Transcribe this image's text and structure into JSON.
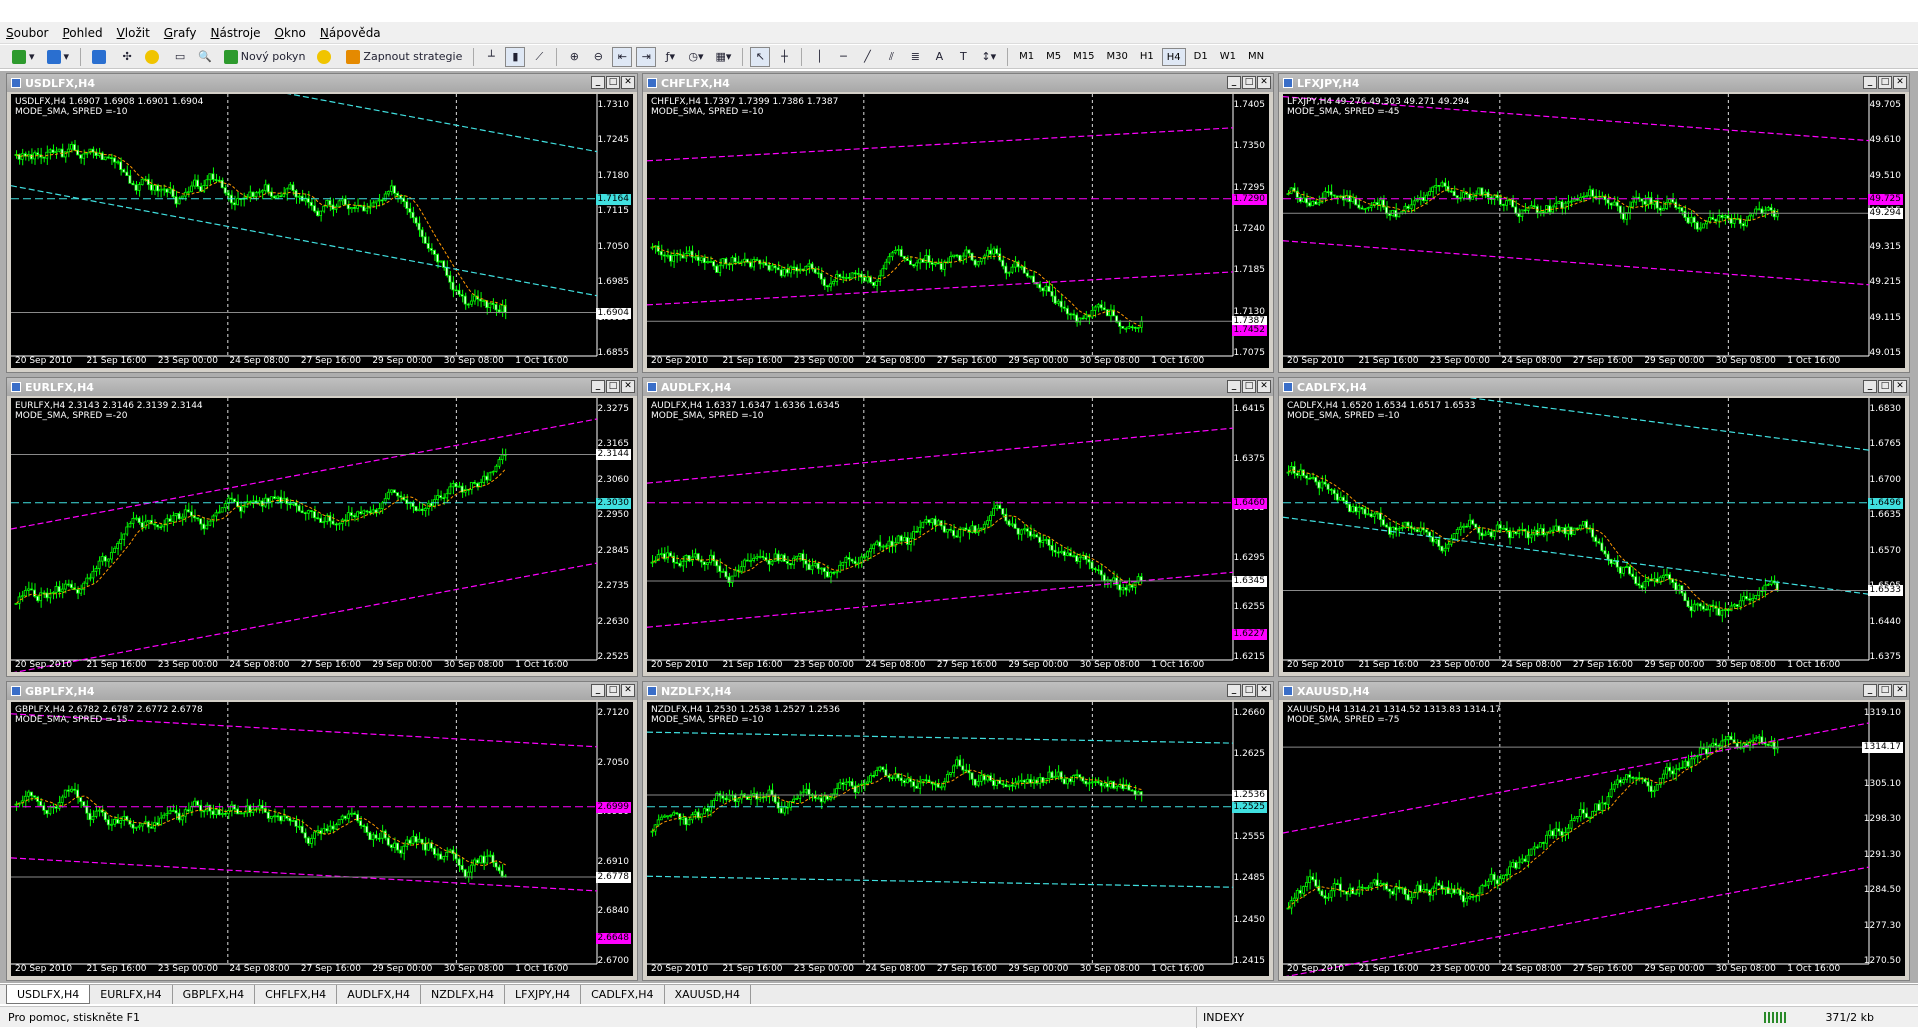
{
  "menu": [
    "Soubor",
    "Pohled",
    "Vložit",
    "Grafy",
    "Nástroje",
    "Okno",
    "Nápověda"
  ],
  "toolbar": {
    "new_order": "Nový pokyn",
    "strategies": "Zapnout strategie",
    "timeframes": [
      "M1",
      "M5",
      "M15",
      "M30",
      "H1",
      "H4",
      "D1",
      "W1",
      "MN"
    ],
    "active_timeframe": "H4"
  },
  "x_axis_labels": [
    "20 Sep 2010",
    "21 Sep 16:00",
    "23 Sep 00:00",
    "24 Sep 08:00",
    "27 Sep 16:00",
    "29 Sep 00:00",
    "30 Sep 08:00",
    "1 Oct 16:00"
  ],
  "colors": {
    "candle": "#00ff00",
    "grid": "#aaaaaa",
    "ma": "#ff9900",
    "cyan": "#40e0e0",
    "magenta": "#ff00ff",
    "red": "#ff3030",
    "orange": "#ff8c1a"
  },
  "charts": [
    {
      "title": "USDLFX,H4",
      "info1": "USDLFX,H4  1.6907 1.6908 1.6901 1.6904",
      "info2": "MODE_SMA, SPRED =-10",
      "yticks": [
        "1.7310",
        "1.7245",
        "1.7180",
        "1.7115",
        "1.7050",
        "1.6985",
        "1.6920",
        "1.6855"
      ],
      "price": "1.6904",
      "tag": "1.7164",
      "tag_color": "cyan",
      "trend": -1,
      "seed": 3
    },
    {
      "title": "CHFLFX,H4",
      "info1": "CHFLFX,H4  1.7397 1.7399 1.7386 1.7387",
      "info2": "MODE_SMA, SPRED =-10",
      "yticks": [
        "1.7405",
        "1.7350",
        "1.7295",
        "1.7240",
        "1.7185",
        "1.7130",
        "1.7075"
      ],
      "price": "1.7387",
      "tag": "1.7290",
      "tag_color": "magenta",
      "tag2": "1.7452",
      "trend": 0.3,
      "seed": 7
    },
    {
      "title": "LFXJPY,H4",
      "info1": "LFXJPY,H4  49.276 49.303 49.271 49.294",
      "info2": "MODE_SMA, SPRED =-45",
      "yticks": [
        "49.705",
        "49.610",
        "49.510",
        "49.415",
        "49.315",
        "49.215",
        "49.115",
        "49.015"
      ],
      "price": "49.294",
      "tag": "49.725",
      "tag_color": "magenta",
      "trend": -0.4,
      "seed": 11
    },
    {
      "title": "EURLFX,H4",
      "info1": "EURLFX,H4  2.3143 2.3146 2.3139 2.3144",
      "info2": "MODE_SMA, SPRED =-20",
      "yticks": [
        "2.3275",
        "2.3165",
        "2.3060",
        "2.2950",
        "2.2845",
        "2.2735",
        "2.2630",
        "2.2525"
      ],
      "price": "2.3144",
      "tag": "2.3030",
      "tag_color": "cyan",
      "trend": 1,
      "seed": 5
    },
    {
      "title": "AUDLFX,H4",
      "info1": "AUDLFX,H4  1.6337 1.6347 1.6336 1.6345",
      "info2": "MODE_SMA, SPRED =-10",
      "yticks": [
        "1.6415",
        "1.6375",
        "1.6335",
        "1.6295",
        "1.6255",
        "1.6215"
      ],
      "price": "1.6345",
      "tag": "1.6460",
      "tag_color": "magenta",
      "tag2": "1.6227",
      "trend": 0.5,
      "seed": 13
    },
    {
      "title": "CADLFX,H4",
      "info1": "CADLFX,H4  1.6520 1.6534 1.6517 1.6533",
      "info2": "MODE_SMA, SPRED =-10",
      "yticks": [
        "1.6830",
        "1.6765",
        "1.6700",
        "1.6635",
        "1.6570",
        "1.6505",
        "1.6440",
        "1.6375"
      ],
      "price": "1.6533",
      "tag": "1.6496",
      "tag_color": "cyan",
      "trend": -0.7,
      "seed": 17
    },
    {
      "title": "GBPLFX,H4",
      "info1": "GBPLFX,H4  2.6782 2.6787 2.6772 2.6778",
      "info2": "MODE_SMA, SPRED =-15",
      "yticks": [
        "2.7120",
        "2.7050",
        "2.6980",
        "2.6910",
        "2.6840",
        "2.6700"
      ],
      "price": "2.6778",
      "tag": "2.6999",
      "tag_color": "magenta",
      "tag2": "2.6648",
      "trend": -0.3,
      "seed": 19
    },
    {
      "title": "NZDLFX,H4",
      "info1": "NZDLFX,H4  1.2530 1.2538 1.2527 1.2536",
      "info2": "MODE_SMA, SPRED =-10",
      "yticks": [
        "1.2660",
        "1.2625",
        "1.2590",
        "1.2555",
        "1.2485",
        "1.2450",
        "1.2415"
      ],
      "price": "1.2536",
      "tag": "1.2525",
      "tag_color": "cyan",
      "trend": -0.1,
      "seed": 23
    },
    {
      "title": "XAUUSD,H4",
      "info1": "XAUUSD,H4  1314.21 1314.52 1313.83 1314.17",
      "info2": "MODE_SMA, SPRED =-75",
      "yticks": [
        "1319.10",
        "1312.00",
        "1305.10",
        "1298.30",
        "1291.30",
        "1284.50",
        "1277.30",
        "1270.50"
      ],
      "price": "1314.17",
      "tag": "",
      "tag_color": "cyan",
      "trend": 1,
      "seed": 29
    }
  ],
  "tabs": [
    "USDLFX,H4",
    "EURLFX,H4",
    "GBPLFX,H4",
    "CHFLFX,H4",
    "AUDLFX,H4",
    "NZDLFX,H4",
    "LFXJPY,H4",
    "CADLFX,H4",
    "XAUUSD,H4"
  ],
  "active_tab": 0,
  "status": {
    "help": "Pro pomoc, stiskněte F1",
    "profile": "INDEXY",
    "traffic": "371/2 kb"
  },
  "window_buttons": {
    "min": "_",
    "max": "□",
    "close": "✕"
  }
}
